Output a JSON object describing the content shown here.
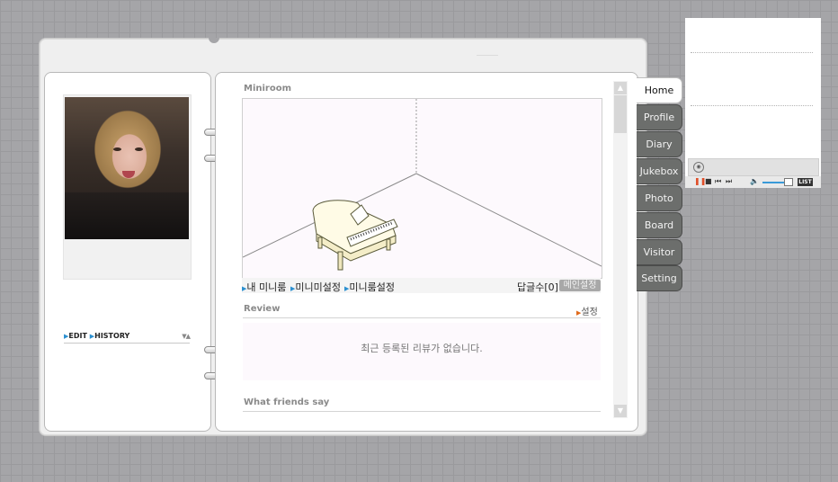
{
  "left_page": {
    "edit_label": "EDIT",
    "history_label": "HISTORY"
  },
  "miniroom": {
    "title": "Miniroom",
    "links": [
      "내 미니룸",
      "미니미설정",
      "미니룸설정"
    ],
    "reply_count": "답글수[0]",
    "main_setting_label": "메인설정"
  },
  "review": {
    "title": "Review",
    "setting_label": "설정",
    "empty_text": "최근 등록된 리뷰가 없습니다."
  },
  "friends": {
    "title": "What friends say"
  },
  "tabs": [
    {
      "label": "Home",
      "active": true
    },
    {
      "label": "Profile"
    },
    {
      "label": "Diary"
    },
    {
      "label": "Jukebox"
    },
    {
      "label": "Photo"
    },
    {
      "label": "Board"
    },
    {
      "label": "Visitor"
    },
    {
      "label": "Setting"
    }
  ],
  "player": {
    "list_label": "LIST"
  },
  "colors": {
    "background": "#a5a5a8",
    "tab_inactive": "#6c6e6c",
    "tab_active": "#ffffff",
    "accent_blue": "#2a8fd0",
    "accent_orange": "#e06a1a"
  },
  "icons": [
    "disc-icon",
    "pause-icon",
    "stop-icon",
    "prev-icon",
    "next-icon",
    "volume-icon",
    "scroll-up-icon",
    "scroll-down-icon",
    "piano-icon"
  ]
}
